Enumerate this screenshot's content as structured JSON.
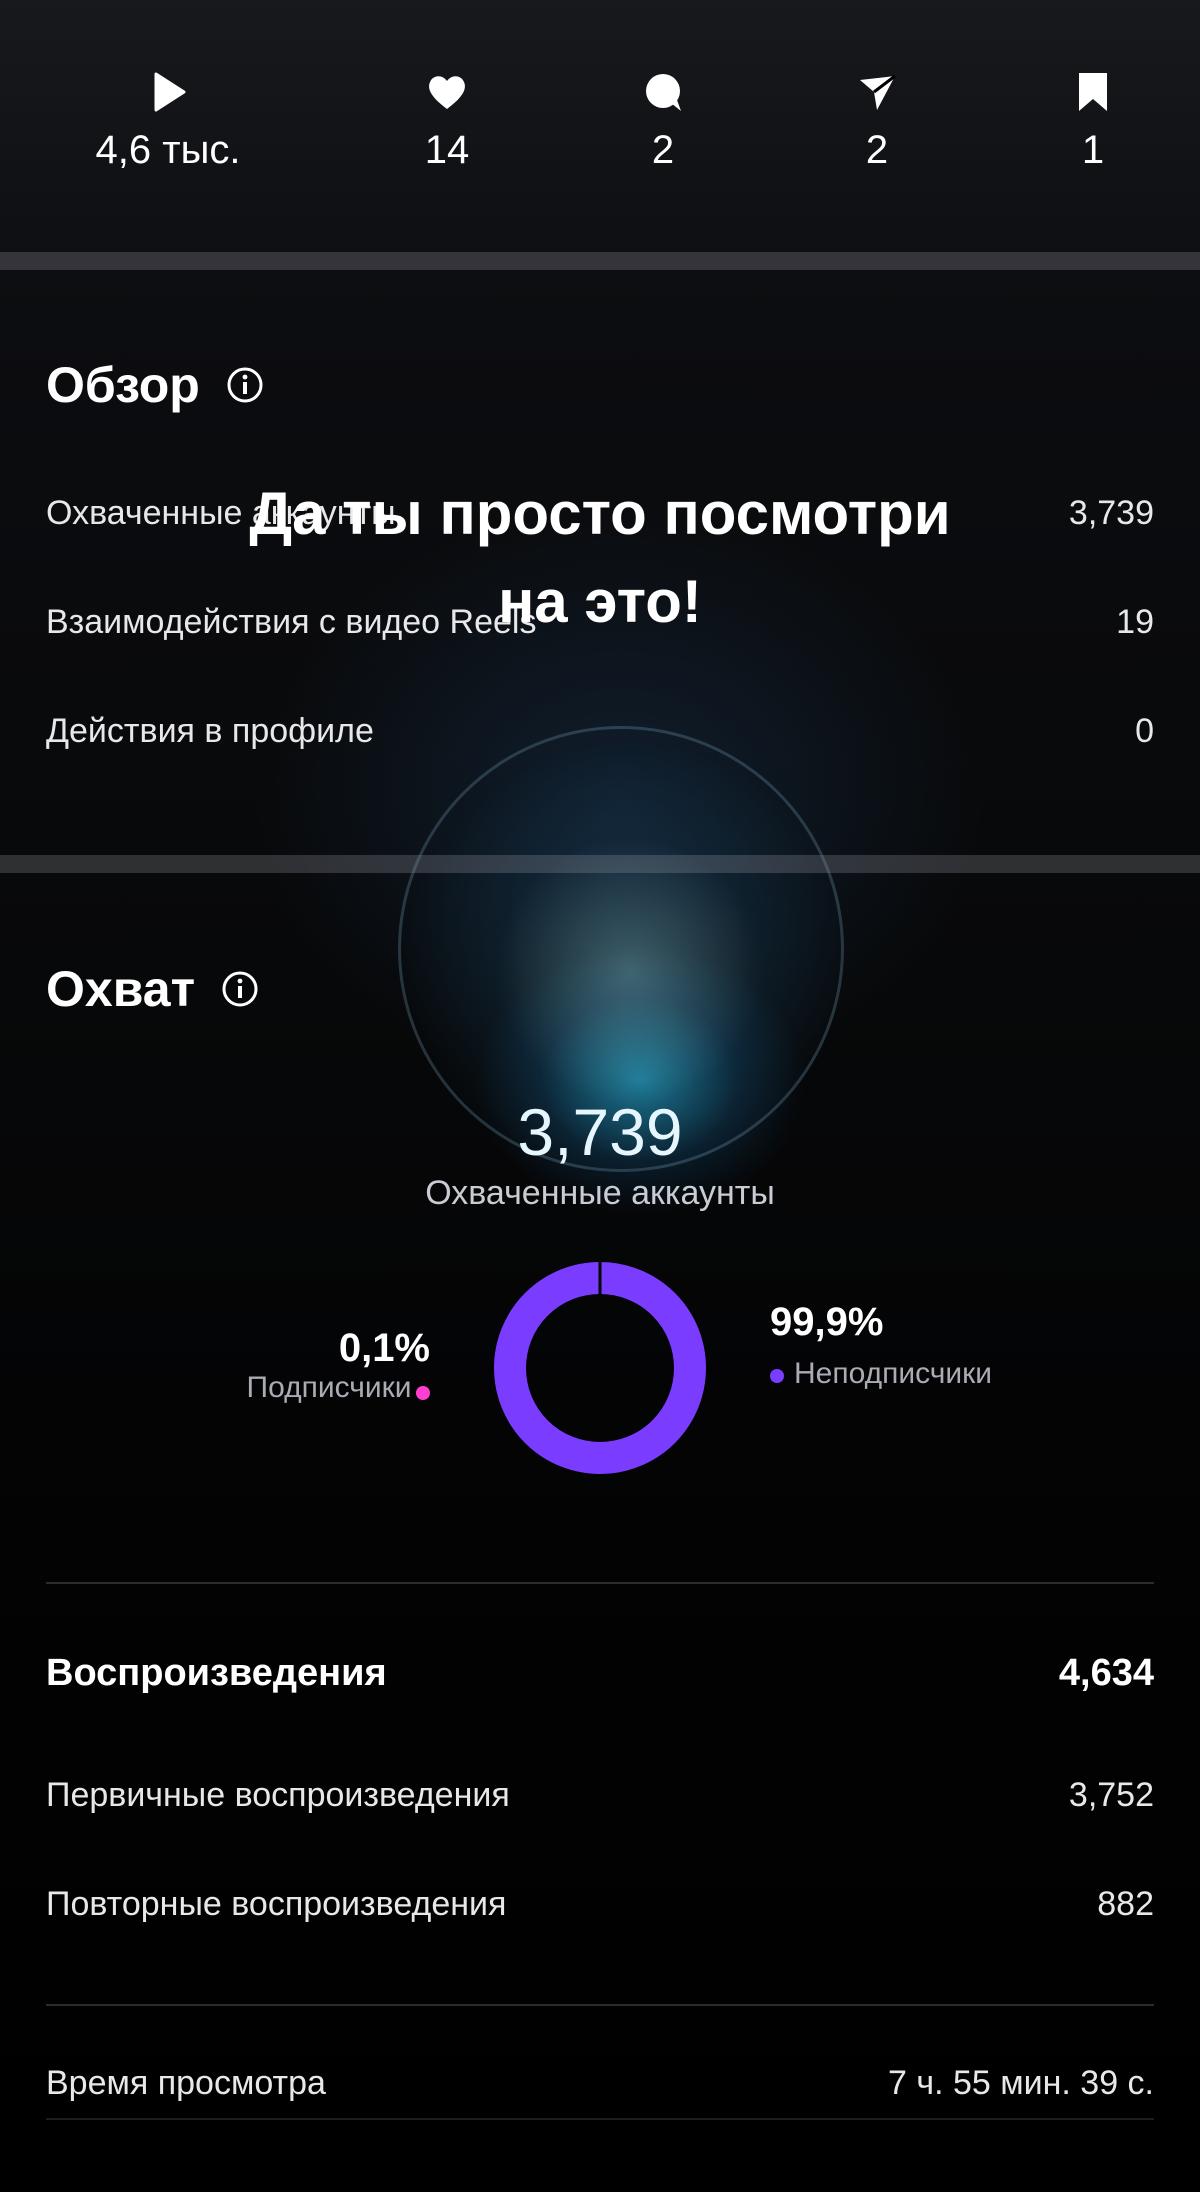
{
  "top_metrics": [
    {
      "icon": "play-icon",
      "value": "4,6 тыс."
    },
    {
      "icon": "heart-icon",
      "value": "14"
    },
    {
      "icon": "comment-icon",
      "value": "2"
    },
    {
      "icon": "send-icon",
      "value": "2"
    },
    {
      "icon": "bookmark-icon",
      "value": "1"
    }
  ],
  "overview": {
    "title": "Обзор",
    "rows": [
      {
        "label": "Охваченные аккаунты",
        "value": "3,739"
      },
      {
        "label": "Взаимодействия с видео Reels",
        "value": "19"
      },
      {
        "label": "Действия в профиле",
        "value": "0"
      }
    ]
  },
  "video_overlay_text": "Да ты просто посмотри на это!",
  "reach": {
    "title": "Охват",
    "total": "3,739",
    "total_label": "Охваченные аккаунты",
    "followers": {
      "percent": "0,1%",
      "label": "Подписчики",
      "color": "#ff3fd0",
      "fraction": 0.001
    },
    "non_followers": {
      "percent": "99,9%",
      "label": "Неподписчики",
      "color": "#7a3cff",
      "fraction": 0.999
    }
  },
  "plays": {
    "title": "Воспроизведения",
    "total": "4,634",
    "rows": [
      {
        "label": "Первичные воспроизведения",
        "value": "3,752"
      },
      {
        "label": "Повторные воспроизведения",
        "value": "882"
      }
    ]
  },
  "watch_time": {
    "label": "Время просмотра",
    "value": "7 ч. 55 мин. 39 с."
  }
}
